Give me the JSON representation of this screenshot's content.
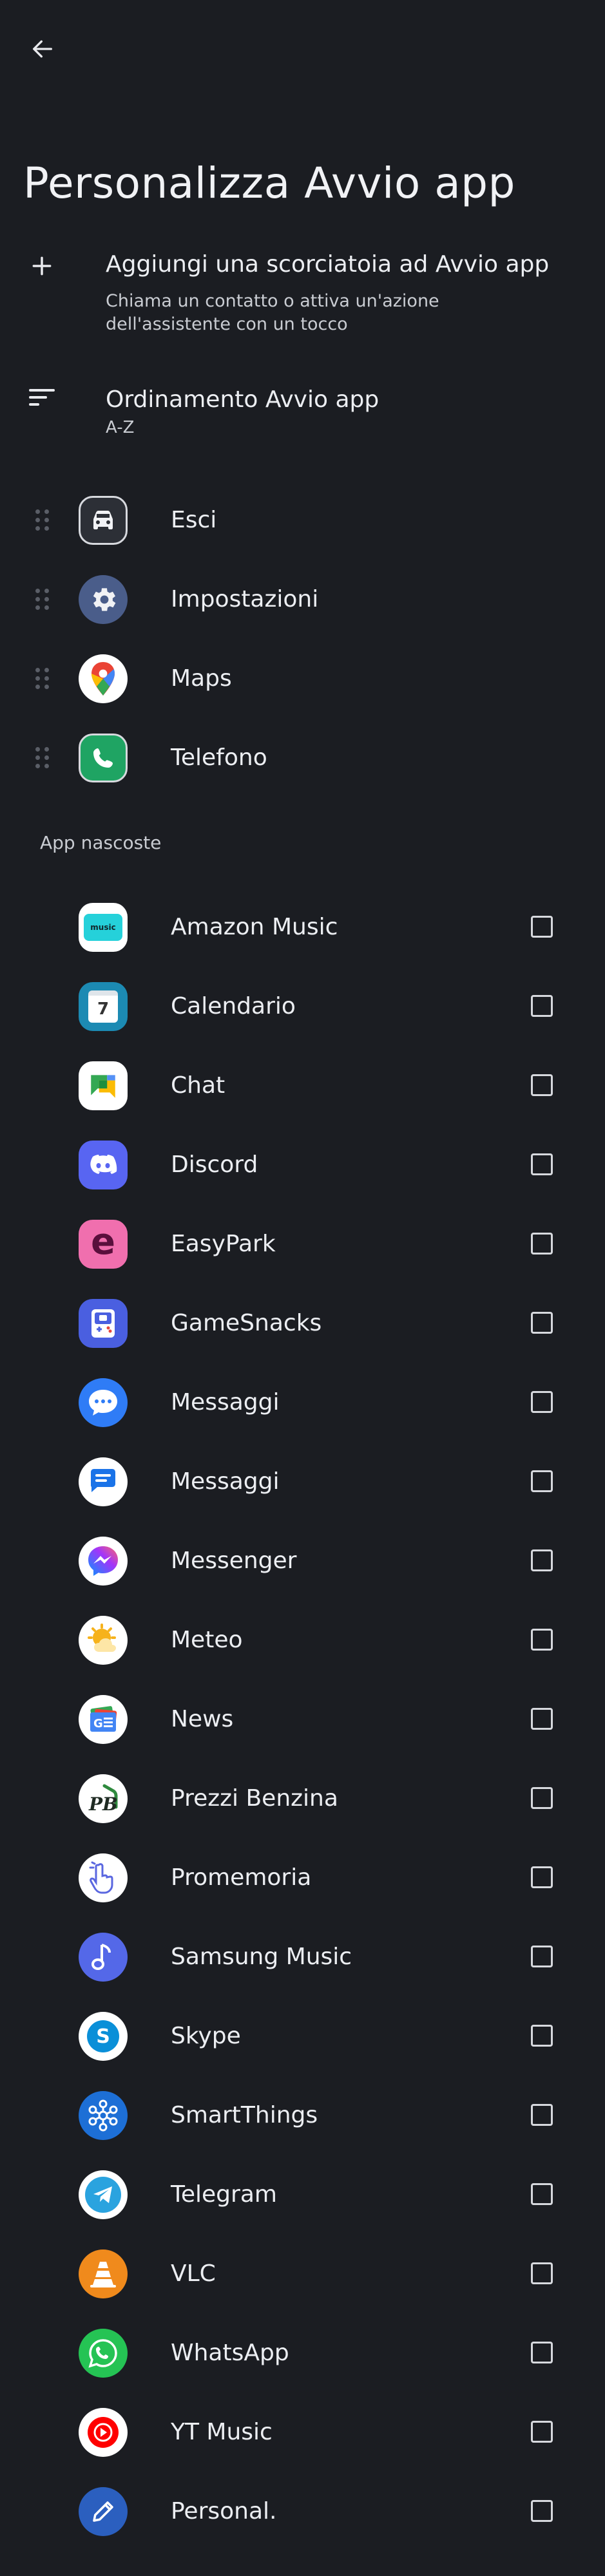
{
  "header": {
    "back_icon": "arrow-left-icon",
    "title": "Personalizza Avvio app"
  },
  "add_shortcut": {
    "icon": "plus-icon",
    "title": "Aggiungi una scorciatoia ad Avvio app",
    "subtitle": "Chiama un contatto o attiva un'azione dell'assistente con un tocco"
  },
  "sort": {
    "icon": "sort-icon",
    "title": "Ordinamento Avvio app",
    "value": "A-Z"
  },
  "pinned_apps": [
    {
      "label": "Esci",
      "icon": "car-icon"
    },
    {
      "label": "Impostazioni",
      "icon": "gear-icon"
    },
    {
      "label": "Maps",
      "icon": "map-pin-icon"
    },
    {
      "label": "Telefono",
      "icon": "phone-icon"
    }
  ],
  "hidden_section": {
    "title": "App nascoste"
  },
  "hidden_apps": [
    {
      "label": "Amazon Music",
      "icon": "amazon-music-icon",
      "checked": false
    },
    {
      "label": "Calendario",
      "icon": "calendar-icon",
      "checked": false
    },
    {
      "label": "Chat",
      "icon": "chat-icon",
      "checked": false
    },
    {
      "label": "Discord",
      "icon": "discord-icon",
      "checked": false
    },
    {
      "label": "EasyPark",
      "icon": "easypark-icon",
      "checked": false
    },
    {
      "label": "GameSnacks",
      "icon": "gamesnacks-icon",
      "checked": false
    },
    {
      "label": "Messaggi",
      "icon": "messages-icon",
      "checked": false
    },
    {
      "label": "Messaggi",
      "icon": "google-messages-icon",
      "checked": false
    },
    {
      "label": "Messenger",
      "icon": "messenger-icon",
      "checked": false
    },
    {
      "label": "Meteo",
      "icon": "weather-icon",
      "checked": false
    },
    {
      "label": "News",
      "icon": "news-icon",
      "checked": false
    },
    {
      "label": "Prezzi Benzina",
      "icon": "fuel-prices-icon",
      "checked": false
    },
    {
      "label": "Promemoria",
      "icon": "reminder-icon",
      "checked": false
    },
    {
      "label": "Samsung Music",
      "icon": "music-note-icon",
      "checked": false
    },
    {
      "label": "Skype",
      "icon": "skype-icon",
      "checked": false
    },
    {
      "label": "SmartThings",
      "icon": "smartthings-icon",
      "checked": false
    },
    {
      "label": "Telegram",
      "icon": "telegram-icon",
      "checked": false
    },
    {
      "label": "VLC",
      "icon": "vlc-cone-icon",
      "checked": false
    },
    {
      "label": "WhatsApp",
      "icon": "whatsapp-icon",
      "checked": false
    },
    {
      "label": "YT Music",
      "icon": "yt-music-icon",
      "checked": false
    },
    {
      "label": "Personal.",
      "icon": "pencil-icon",
      "checked": false
    }
  ]
}
